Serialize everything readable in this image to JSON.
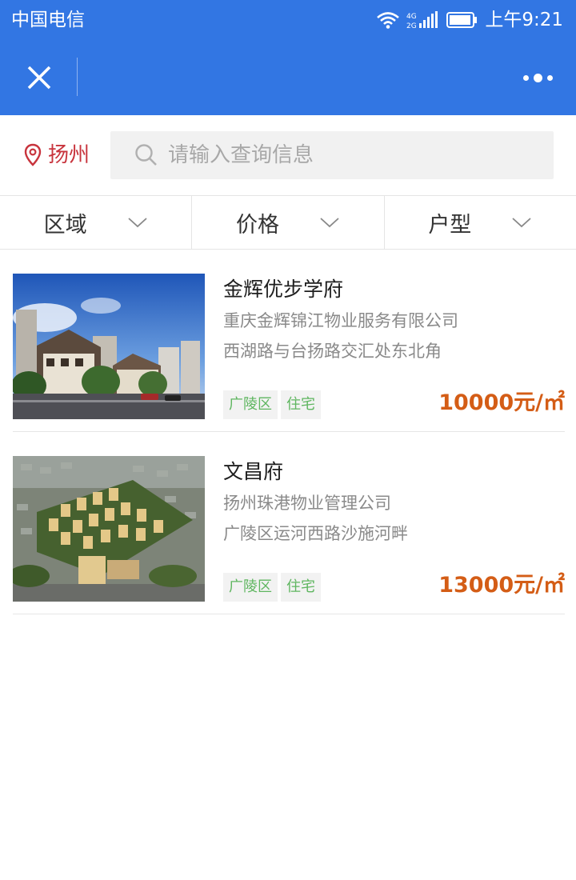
{
  "status_bar": {
    "carrier": "中国电信",
    "network": "4G 2G",
    "time": "上午9:21"
  },
  "nav": {
    "close_icon": "close-icon",
    "more_icon": "more-dots-icon",
    "header_color": "#3276e3"
  },
  "search": {
    "city": "扬州",
    "placeholder": "请输入查询信息"
  },
  "filters": [
    {
      "label": "区域"
    },
    {
      "label": "价格"
    },
    {
      "label": "户型"
    }
  ],
  "listings": [
    {
      "name": "金辉优步学府",
      "company": "重庆金辉锦江物业服务有限公司",
      "address": "西湖路与台扬路交汇处东北角",
      "tags": [
        "广陵区",
        "住宅"
      ],
      "price": "10000元/㎡"
    },
    {
      "name": "文昌府",
      "company": "扬州珠港物业管理公司",
      "address": "广陵区运河西路沙施河畔",
      "tags": [
        "广陵区",
        "住宅"
      ],
      "price": "13000元/㎡"
    }
  ],
  "colors": {
    "price": "#d45d16",
    "tag_text": "#5fb660",
    "city": "#c8343d"
  }
}
